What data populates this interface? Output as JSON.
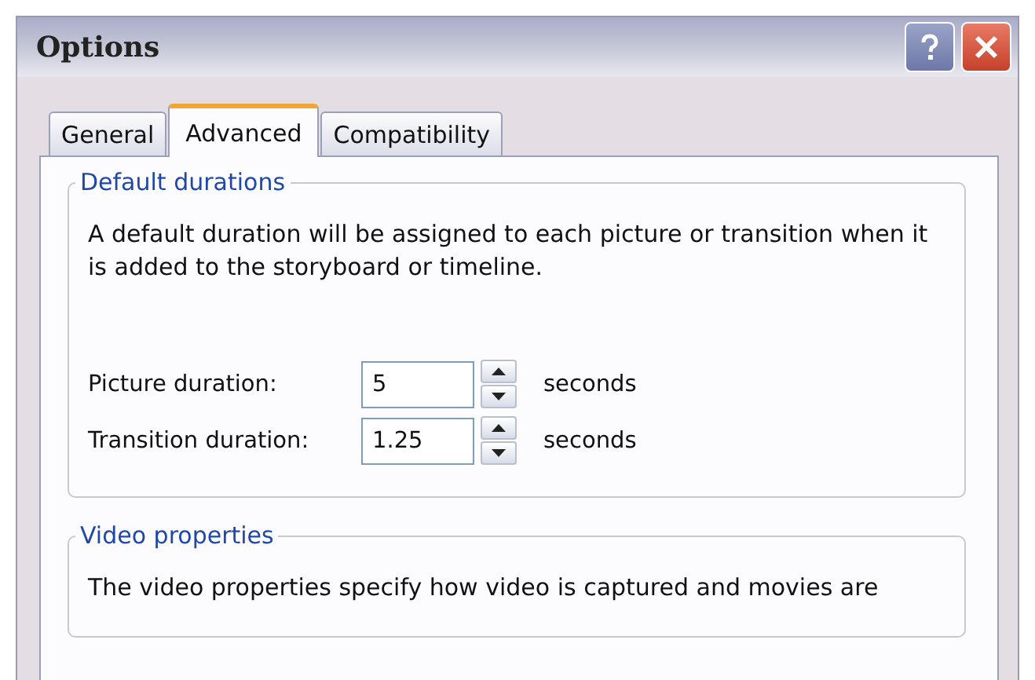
{
  "window": {
    "title": "Options"
  },
  "tabs": [
    {
      "label": "General",
      "selected": false
    },
    {
      "label": "Advanced",
      "selected": true
    },
    {
      "label": "Compatibility",
      "selected": false
    }
  ],
  "groups": [
    {
      "legend": "Default durations",
      "text": "A default duration will be assigned to each picture or transition when it is added to the storyboard or timeline.",
      "fields": [
        {
          "label": "Picture duration:",
          "value": "5",
          "unit": "seconds"
        },
        {
          "label": "Transition duration:",
          "value": "1.25",
          "unit": "seconds"
        }
      ]
    },
    {
      "legend": "Video properties",
      "text": "The video properties specify how video is captured and movies are"
    }
  ]
}
